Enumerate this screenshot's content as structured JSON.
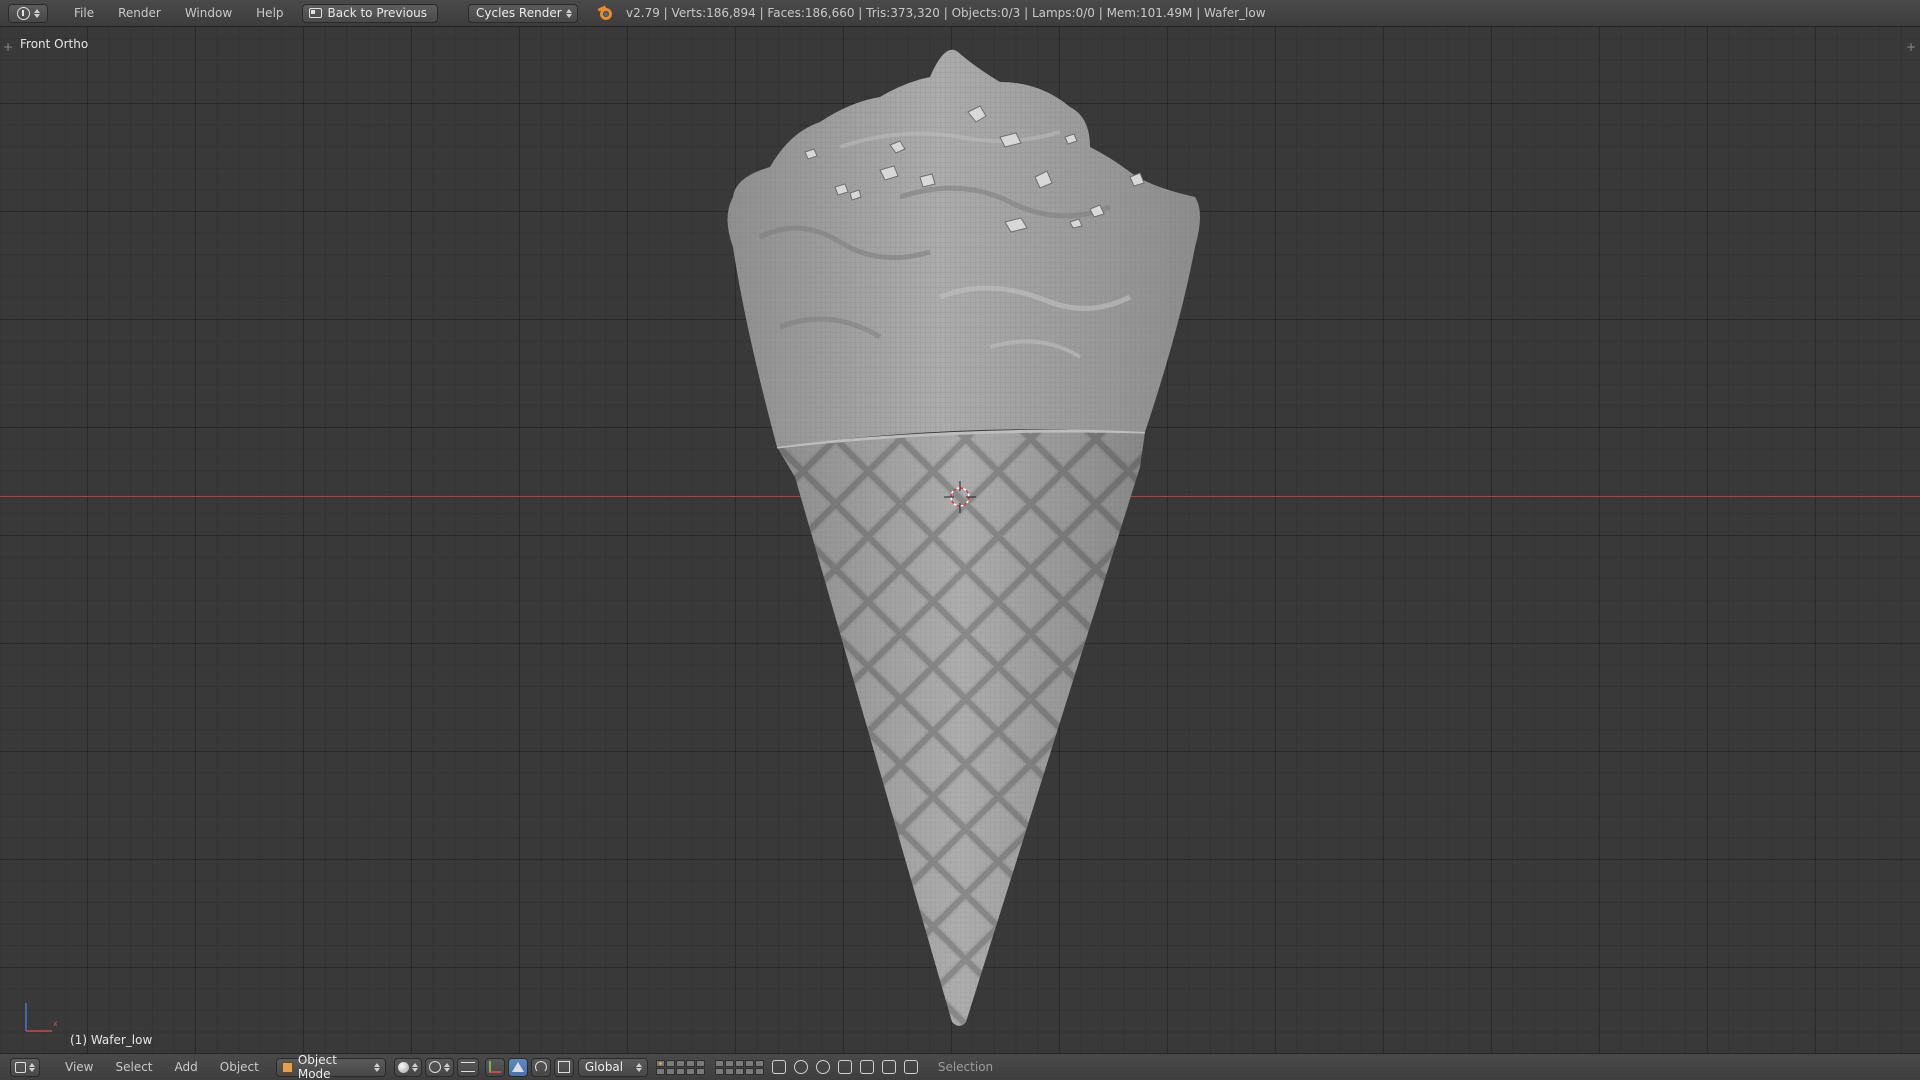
{
  "top_header": {
    "menus": [
      "File",
      "Render",
      "Window",
      "Help"
    ],
    "back_button_label": "Back to Previous",
    "render_engine": "Cycles Render",
    "stats": "v2.79 | Verts:186,894 | Faces:186,660 | Tris:373,320 | Objects:0/3 | Lamps:0/0 | Mem:101.49M | Wafer_low"
  },
  "viewport": {
    "view_label": "Front Ortho",
    "active_object_label": "(1) Wafer_low",
    "axis_colors": {
      "x": "#c54b4b",
      "z": "#4f6fd6"
    }
  },
  "bottom_header": {
    "menus": [
      "View",
      "Select",
      "Add",
      "Object"
    ],
    "mode": "Object Mode",
    "transform_orientation": "Global",
    "status": "Selection"
  },
  "colors": {
    "background": "#393939",
    "header": "#454545",
    "accent": "#5680c2",
    "model": "#9a9a9a"
  }
}
